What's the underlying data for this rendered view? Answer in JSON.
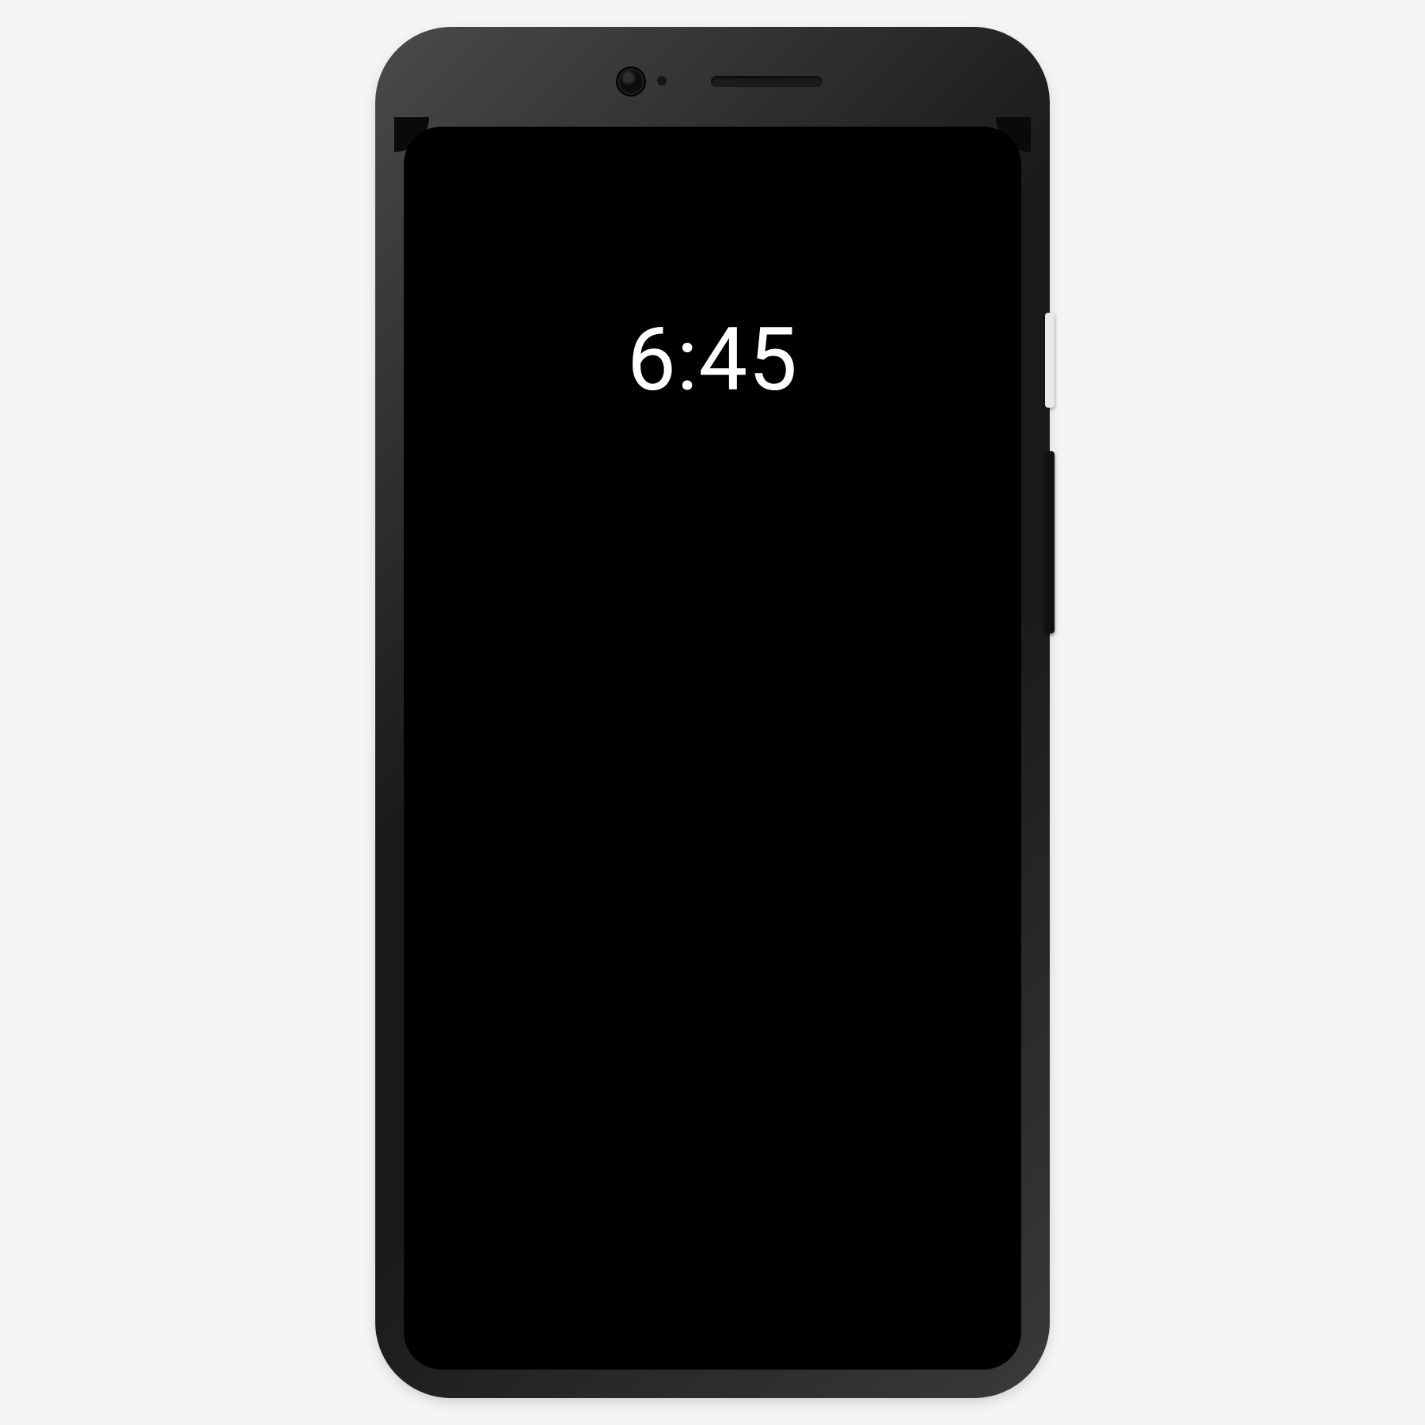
{
  "clock": {
    "time": "6:45"
  }
}
